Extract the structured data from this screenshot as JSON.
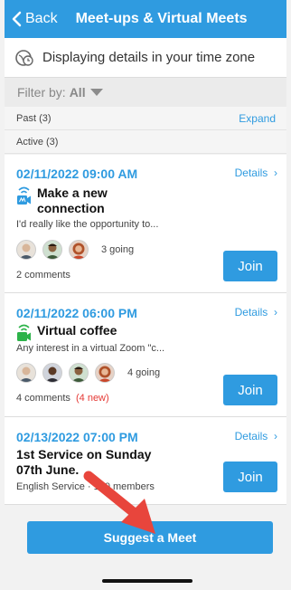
{
  "navbar": {
    "back_label": "Back",
    "title": "Meet-ups & Virtual Meets"
  },
  "timezone_notice": "Displaying details in your time zone",
  "filter": {
    "label": "Filter by:",
    "value": "All"
  },
  "sections": {
    "past": "Past (3)",
    "expand": "Expand",
    "active": "Active (3)"
  },
  "events": [
    {
      "date": "02/11/2022 09:00 AM",
      "details_label": "Details",
      "title": "Make a new connection",
      "icon": "video-camera-icon",
      "description": "I'd really like the opportunity to...",
      "going": "3 going",
      "comments": "2 comments",
      "new_comments": "",
      "join_label": "Join"
    },
    {
      "date": "02/11/2022 06:00 PM",
      "details_label": "Details",
      "title": "Virtual coffee",
      "icon": "video-camera-icon",
      "description": "Any interest in a virtual Zoom \"c...",
      "going": "4 going",
      "comments": "4 comments",
      "new_comments": "(4 new)",
      "join_label": "Join"
    },
    {
      "date": "02/13/2022 07:00 PM",
      "details_label": "Details",
      "title": "1st Service on Sunday 07th June.",
      "icon": "",
      "description": "English Service",
      "members": "100 members",
      "join_label": "Join"
    }
  ],
  "suggest_button": "Suggest a Meet",
  "colors": {
    "accent": "#2f9be0",
    "new_badge": "#e53935",
    "green_icon": "#2db34a",
    "annotation_arrow": "#e8453c"
  }
}
